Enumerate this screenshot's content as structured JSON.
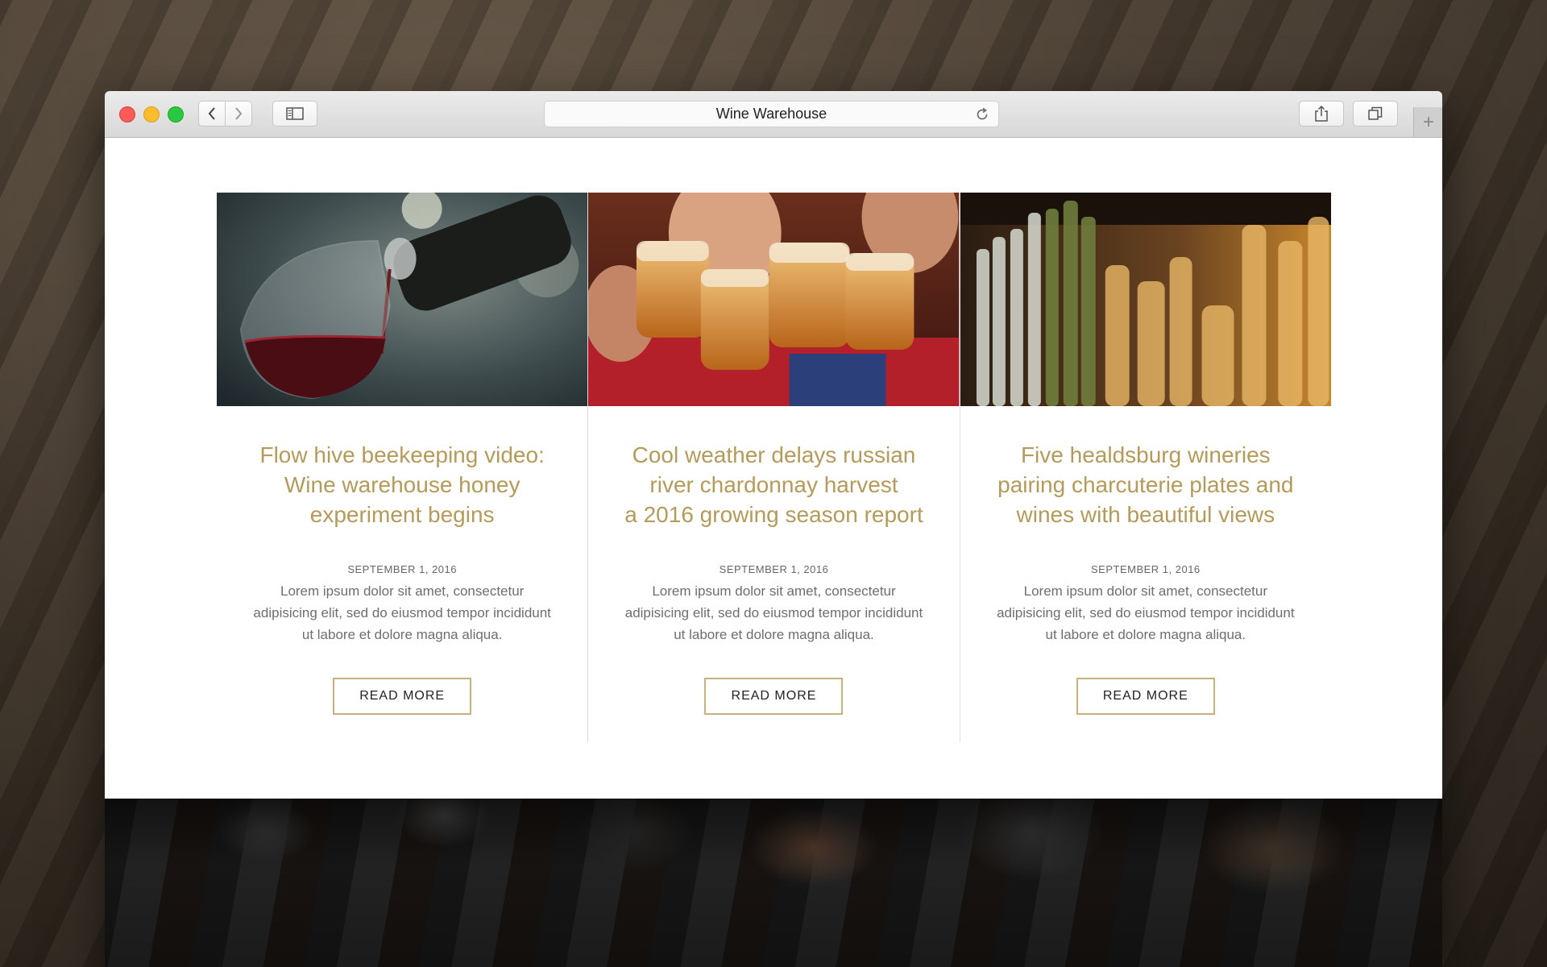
{
  "browser": {
    "title": "Wine Warehouse",
    "icons": {
      "back": "chevron-left-icon",
      "forward": "chevron-right-icon",
      "sidebar": "sidebar-icon",
      "reload": "reload-icon",
      "share": "share-icon",
      "tabs": "tabs-icon",
      "new_tab": "plus-icon"
    }
  },
  "articles": [
    {
      "title": "Flow hive beekeeping video:\nWine warehouse honey\nexperiment begins",
      "date": "SEPTEMBER 1, 2016",
      "excerpt": "Lorem ipsum dolor sit amet, consectetur adipisicing elit, sed do eiusmod tempor incididunt ut labore et dolore magna aliqua.",
      "button": "READ MORE"
    },
    {
      "title": "Cool weather delays russian\nriver chardonnay harvest\na 2016 growing season report",
      "date": "SEPTEMBER 1, 2016",
      "excerpt": "Lorem ipsum dolor sit amet, consectetur adipisicing elit, sed do eiusmod tempor incididunt ut labore et dolore magna aliqua.",
      "button": "READ MORE"
    },
    {
      "title": "Five healdsburg wineries\npairing charcuterie plates and\nwines with beautiful views",
      "date": "SEPTEMBER 1, 2016",
      "excerpt": "Lorem ipsum dolor sit amet, consectetur adipisicing elit, sed do eiusmod tempor incididunt ut labore et dolore magna aliqua.",
      "button": "READ MORE"
    }
  ],
  "colors": {
    "title_gold": "#b49a5b",
    "button_border": "#c5b27f"
  }
}
